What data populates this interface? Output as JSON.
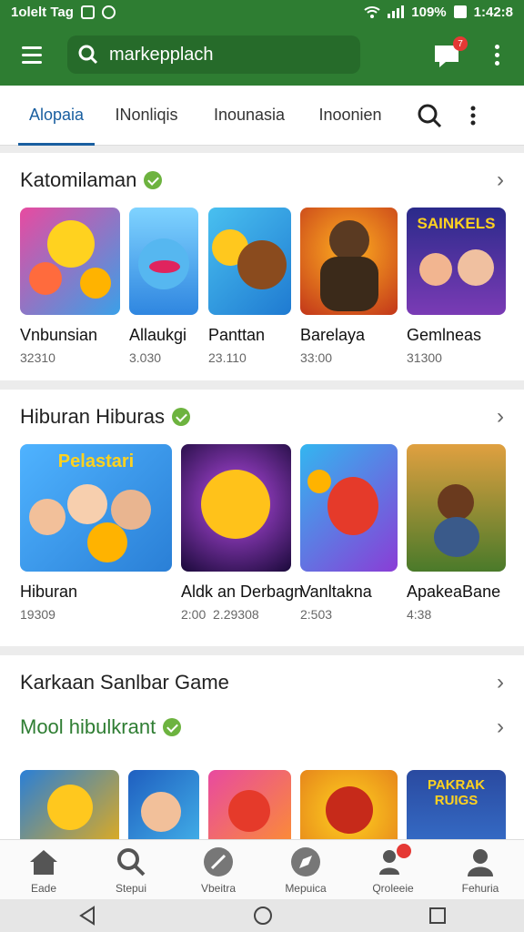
{
  "status": {
    "carrier": "1olelt Tag",
    "battery": "109%",
    "time": "1:42:8"
  },
  "search": {
    "value": "markepplach"
  },
  "chat": {
    "badge": "7"
  },
  "tabs": [
    "Alopaia",
    "INonliqis",
    "Inounasia",
    "Inoonien"
  ],
  "sections": [
    {
      "title": "Katomilaman",
      "items": [
        {
          "name": "Vnbunsian",
          "value": "32310"
        },
        {
          "name": "Allaukgi",
          "value": "3.030"
        },
        {
          "name": "Panttan",
          "value": "23.110"
        },
        {
          "name": "Barelaya",
          "value": "33:00"
        },
        {
          "name": "Gemlneas",
          "value": "31300"
        }
      ]
    },
    {
      "title": "Hiburan Hiburas",
      "items": [
        {
          "name": "Hiburan",
          "value": "19309",
          "art_text": "Pelastari"
        },
        {
          "name": "Aldk",
          "value": "2:00"
        },
        {
          "name": "an Derbagn",
          "value": "2.29308"
        },
        {
          "name": "Vanltakna",
          "value": "2:503"
        },
        {
          "name": "ApakeaBane",
          "value": "4:38"
        }
      ]
    },
    {
      "title": "Karkaan Sanlbar Game",
      "subtitle": "Mool hibulkrant",
      "items": [
        {
          "name": ""
        },
        {
          "name": ""
        },
        {
          "name": ""
        },
        {
          "name": ""
        },
        {
          "name": "",
          "art_text": "PAKRAK RUIGS"
        }
      ]
    }
  ],
  "nav": [
    {
      "label": "Eade",
      "icon": "home-icon"
    },
    {
      "label": "Stepui",
      "icon": "search-icon"
    },
    {
      "label": "Vbeitra",
      "icon": "pen-icon"
    },
    {
      "label": "Mepuica",
      "icon": "compass-icon"
    },
    {
      "label": "Qroleeie",
      "icon": "people-icon"
    },
    {
      "label": "Fehuria",
      "icon": "person-icon"
    }
  ],
  "thumb1_art": "SAINKELS",
  "colors": {
    "appbar": "#2e7d32",
    "accent": "#1a5fa0",
    "verified": "#6db33f"
  }
}
